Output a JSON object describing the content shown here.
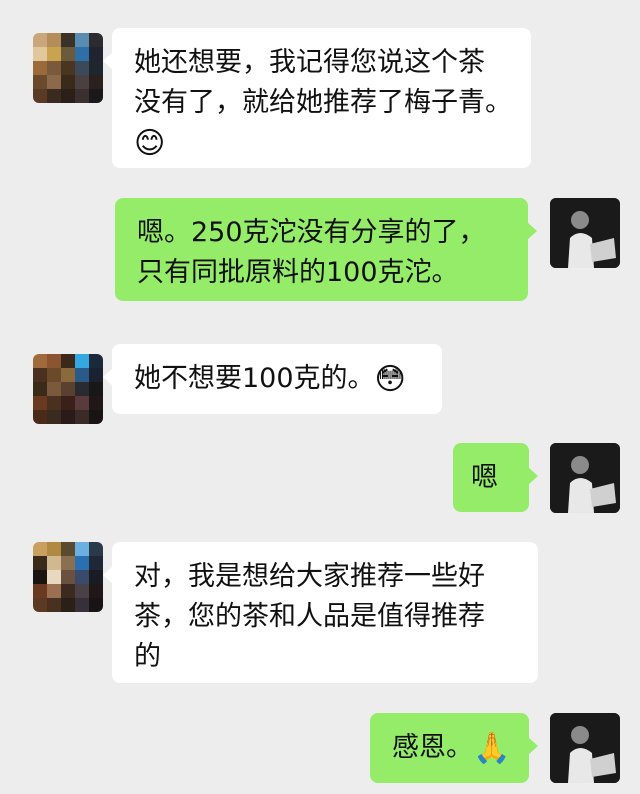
{
  "messages": [
    {
      "side": "left",
      "lines": [
        "她还想要，我记得您说这个茶",
        "没有了，就给她推荐了梅子青。"
      ],
      "emoji": "😊",
      "emoji_name": "smiling-face-emoji"
    },
    {
      "side": "right",
      "lines": [
        "嗯。250克沱没有分享的了，",
        "只有同批原料的100克沱。"
      ]
    },
    {
      "side": "left",
      "lines": [
        "她不想要100克的。"
      ],
      "emoji": "😳",
      "emoji_name": "wide-eyed-face-emoji"
    },
    {
      "side": "right",
      "lines": [
        "嗯"
      ]
    },
    {
      "side": "left",
      "lines": [
        "对，我是想给大家推荐一些好",
        "茶，您的茶和人品是值得推荐",
        "的"
      ]
    },
    {
      "side": "right",
      "lines": [
        "感恩。"
      ],
      "emoji": "🙏",
      "emoji_name": "folded-hands-emoji"
    }
  ],
  "colors": {
    "background": "#ededed",
    "incoming_bubble": "#ffffff",
    "outgoing_bubble": "#95ec69"
  },
  "avatars": {
    "contact": "pixelated-avatar",
    "self": "photo-avatar"
  }
}
